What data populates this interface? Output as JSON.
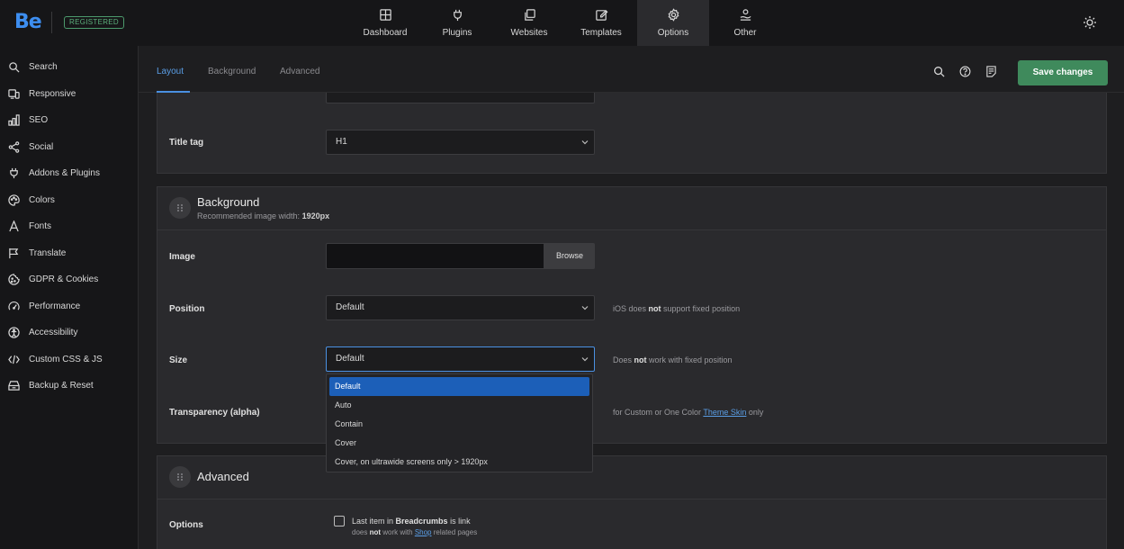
{
  "brand": {
    "logo": "Be",
    "badge": "REGISTERED"
  },
  "topnav": [
    {
      "label": "Dashboard",
      "icon": "grid-icon"
    },
    {
      "label": "Plugins",
      "icon": "plug-icon"
    },
    {
      "label": "Websites",
      "icon": "copy-icon"
    },
    {
      "label": "Templates",
      "icon": "edit-icon"
    },
    {
      "label": "Options",
      "icon": "gear-icon",
      "active": true
    },
    {
      "label": "Other",
      "icon": "hand-icon"
    }
  ],
  "sidebar": {
    "items": [
      {
        "label": "Search",
        "icon": "search-icon"
      },
      {
        "label": "Responsive",
        "icon": "devices-icon"
      },
      {
        "label": "SEO",
        "icon": "bar-chart-icon"
      },
      {
        "label": "Social",
        "icon": "share-icon"
      },
      {
        "label": "Addons & Plugins",
        "icon": "plug-icon"
      },
      {
        "label": "Colors",
        "icon": "palette-icon"
      },
      {
        "label": "Fonts",
        "icon": "font-icon"
      },
      {
        "label": "Translate",
        "icon": "flag-icon"
      },
      {
        "label": "GDPR & Cookies",
        "icon": "cookie-icon"
      },
      {
        "label": "Performance",
        "icon": "gauge-icon"
      },
      {
        "label": "Accessibility",
        "icon": "accessibility-icon"
      },
      {
        "label": "Custom CSS & JS",
        "icon": "code-icon"
      },
      {
        "label": "Backup & Reset",
        "icon": "archive-icon"
      }
    ]
  },
  "tabs": [
    {
      "label": "Layout",
      "active": true
    },
    {
      "label": "Background"
    },
    {
      "label": "Advanced"
    }
  ],
  "toolbar": {
    "save_label": "Save changes"
  },
  "title_card": {
    "title_tag_label": "Title tag",
    "title_tag_value": "H1"
  },
  "background_card": {
    "title": "Background",
    "subtitle_prefix": "Recommended image width: ",
    "subtitle_value": "1920px",
    "image_label": "Image",
    "browse_label": "Browse",
    "position_label": "Position",
    "position_value": "Default",
    "position_hint_pre": "iOS does ",
    "position_hint_bold": "not",
    "position_hint_post": " support fixed position",
    "size_label": "Size",
    "size_value": "Default",
    "size_hint_pre": "Does ",
    "size_hint_bold": "not",
    "size_hint_post": " work with fixed position",
    "transparency_label": "Transparency (alpha)",
    "transparency_hint_pre": "for Custom or One Color ",
    "transparency_hint_link": "Theme Skin",
    "transparency_hint_post": " only"
  },
  "size_dropdown": {
    "options": [
      "Default",
      "Auto",
      "Contain",
      "Cover",
      "Cover, on ultrawide screens only > 1920px"
    ],
    "selected": "Default"
  },
  "advanced_card": {
    "title": "Advanced",
    "options_label": "Options",
    "checkbox_pre": "Last item in ",
    "checkbox_bold": "Breadcrumbs",
    "checkbox_post": " is link",
    "checkbox_sub_pre": "does ",
    "checkbox_sub_bold": "not",
    "checkbox_sub_mid": " work with ",
    "checkbox_sub_link": "Shop",
    "checkbox_sub_post": " related pages"
  },
  "colors": {
    "accent": "#4a90e2",
    "save": "#3f8a5c",
    "badge": "#5cb07c",
    "selected_option": "#1c5fb8"
  }
}
